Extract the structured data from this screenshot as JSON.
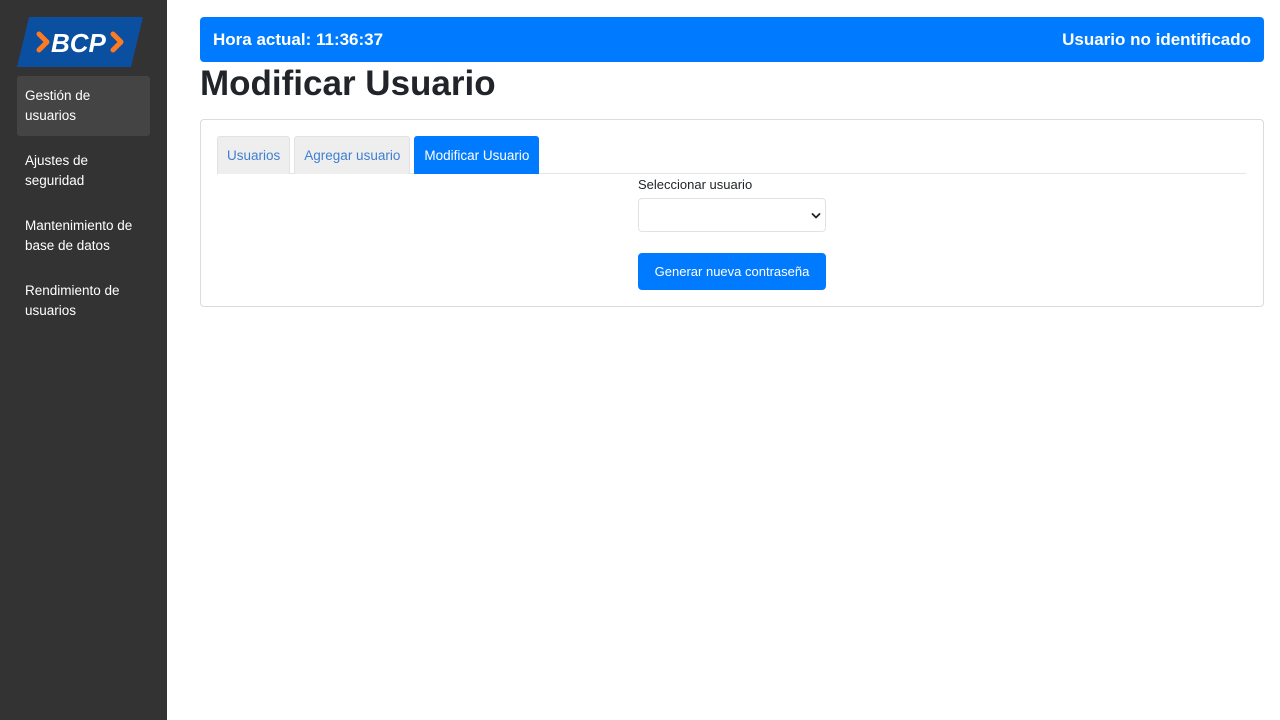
{
  "brand": {
    "logo_text": "BCP",
    "logo_bg": "#0a4fa0",
    "logo_accent": "#ff7a21"
  },
  "sidebar": {
    "items": [
      {
        "label": "Gestión de usuarios",
        "active": true
      },
      {
        "label": "Ajustes de seguridad",
        "active": false
      },
      {
        "label": "Mantenimiento de base de datos",
        "active": false
      },
      {
        "label": "Rendimiento de usuarios",
        "active": false
      }
    ]
  },
  "header": {
    "time_text": "Hora actual: 11:36:37",
    "user_status": "Usuario no identificado"
  },
  "page": {
    "title": "Modificar Usuario"
  },
  "tabs": [
    {
      "label": "Usuarios",
      "active": false
    },
    {
      "label": "Agregar usuario",
      "active": false
    },
    {
      "label": "Modificar Usuario",
      "active": true
    }
  ],
  "form": {
    "select_label": "Seleccionar usuario",
    "select_value": "",
    "button_label": "Generar nueva contraseña"
  },
  "colors": {
    "primary": "#007bff",
    "sidebar": "#333333"
  }
}
